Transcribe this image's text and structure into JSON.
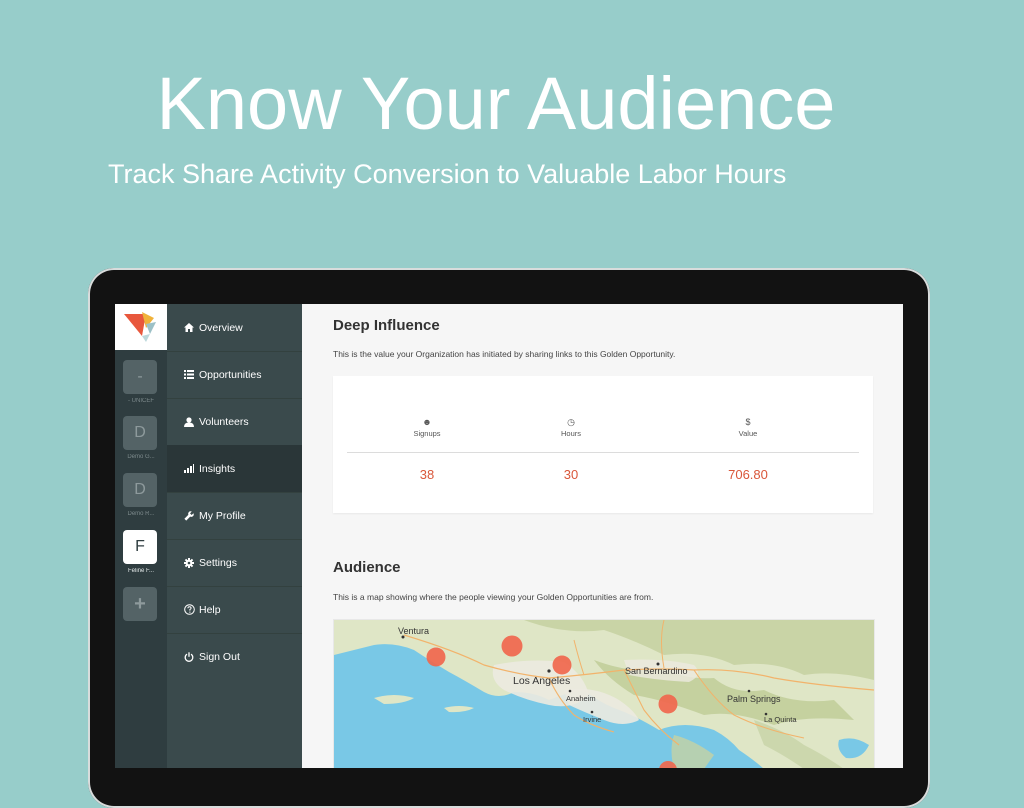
{
  "hero": {
    "title": "Know Your Audience",
    "subtitle": "Track Share Activity Conversion to Valuable Labor Hours"
  },
  "org_rail": {
    "orgs": [
      {
        "initial": "-",
        "label": "- UNICEF"
      },
      {
        "initial": "D",
        "label": "Demo G..."
      },
      {
        "initial": "D",
        "label": "Demo R..."
      },
      {
        "initial": "F",
        "label": "Feline F..."
      }
    ],
    "add_label": "+"
  },
  "nav": {
    "items": [
      {
        "label": "Overview",
        "icon": "home-icon"
      },
      {
        "label": "Opportunities",
        "icon": "list-icon"
      },
      {
        "label": "Volunteers",
        "icon": "user-icon"
      },
      {
        "label": "Insights",
        "icon": "bar-chart-icon"
      },
      {
        "label": "My Profile",
        "icon": "wrench-icon"
      },
      {
        "label": "Settings",
        "icon": "gear-icon"
      },
      {
        "label": "Help",
        "icon": "help-icon"
      },
      {
        "label": "Sign Out",
        "icon": "power-icon"
      }
    ],
    "active": "Insights"
  },
  "deep_influence": {
    "title": "Deep Influence",
    "description": "This is the value your Organization has initiated by sharing links to this Golden Opportunity.",
    "stats": [
      {
        "icon_glyph": "☻",
        "label": "Signups",
        "value": "38"
      },
      {
        "icon_glyph": "◷",
        "label": "Hours",
        "value": "30"
      },
      {
        "icon_glyph": "$",
        "label": "Value",
        "value": "706.80"
      }
    ]
  },
  "audience": {
    "title": "Audience",
    "description": "This is a map showing where the people viewing your Golden Opportunities are from.",
    "map_labels": {
      "ventura": "Ventura",
      "los_angeles": "Los Angeles",
      "san_bernardino": "San Bernardino",
      "anaheim": "Anaheim",
      "irvine": "Irvine",
      "palm_springs": "Palm Springs",
      "la_quinta": "La Quinta"
    }
  },
  "colors": {
    "background": "#97cdca",
    "sidebar": "#3a4a4c",
    "accent": "#d9573a",
    "marker": "#f0674d"
  }
}
